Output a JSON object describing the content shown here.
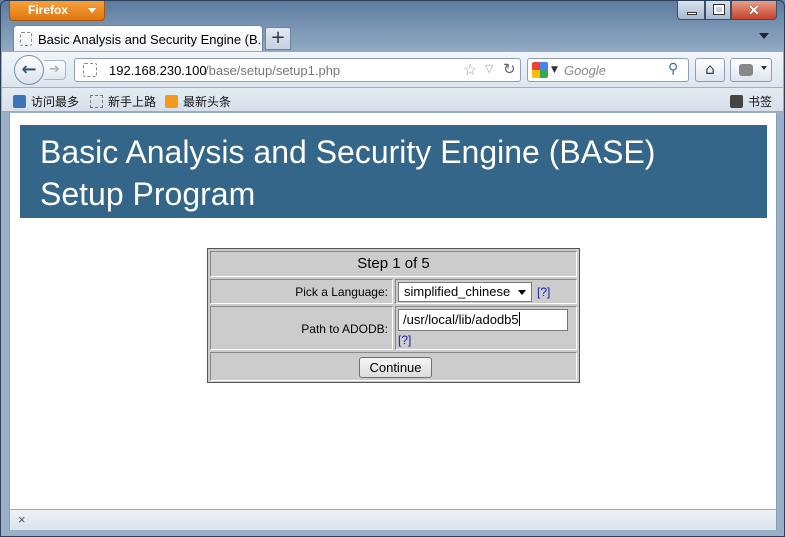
{
  "browser": {
    "app_button": "Firefox",
    "tab": {
      "title": "Basic Analysis and Security Engine (B..."
    },
    "url": {
      "host": "192.168.230.100",
      "path": "/base/setup/setup1.php"
    },
    "search": {
      "placeholder": "Google"
    },
    "bookmarks": [
      {
        "label": "访问最多"
      },
      {
        "label": "新手上路"
      },
      {
        "label": "最新头条"
      }
    ],
    "bookmarks_menu": "书签"
  },
  "page": {
    "banner": {
      "line1": "Basic Analysis and Security Engine (BASE)",
      "line2": "Setup Program"
    },
    "setup": {
      "step": "Step 1 of 5",
      "language_label": "Pick a Language:",
      "language_value": "simplified_chinese",
      "help": "[?]",
      "adodb_label": "Path to ADODB:",
      "adodb_value": "/usr/local/lib/adodb5",
      "continue": "Continue"
    }
  },
  "statusbar": {
    "close_glyph": "×"
  },
  "colors": {
    "banner": "#336688",
    "form_bg": "#cccccc",
    "firefox_orange": "#e0760f"
  }
}
